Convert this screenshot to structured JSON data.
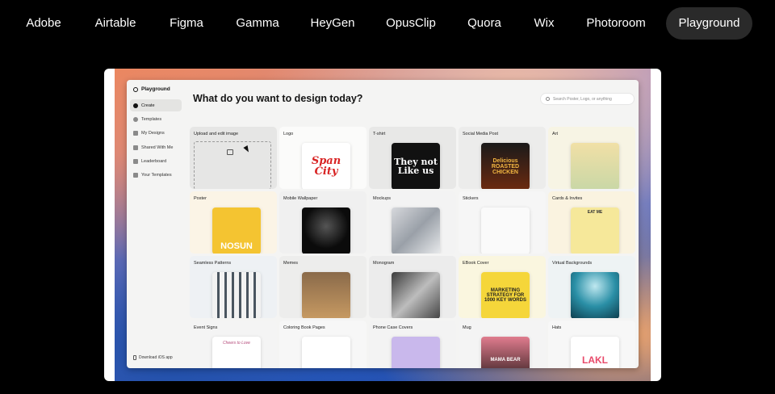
{
  "tabs": [
    {
      "label": "Adobe"
    },
    {
      "label": "Airtable"
    },
    {
      "label": "Figma"
    },
    {
      "label": "Gamma"
    },
    {
      "label": "HeyGen"
    },
    {
      "label": "OpusClip"
    },
    {
      "label": "Quora"
    },
    {
      "label": "Wix"
    },
    {
      "label": "Photoroom"
    },
    {
      "label": "Playground"
    }
  ],
  "active_tab": "Playground",
  "app": {
    "brand": "Playground",
    "nav": [
      {
        "label": "Create",
        "active": true
      },
      {
        "label": "Templates"
      },
      {
        "label": "My Designs"
      },
      {
        "label": "Shared With Me"
      },
      {
        "label": "Leaderboard"
      },
      {
        "label": "Your Templates"
      }
    ],
    "ios_link": "Download iOS app",
    "headline": "What do you want to design today?",
    "search_placeholder": "Search Poster, Logo, or anything",
    "cards": [
      {
        "label": "Upload and edit image"
      },
      {
        "label": "Logo",
        "thumb": "Span City"
      },
      {
        "label": "T-shirt",
        "thumb": "They not Like us"
      },
      {
        "label": "Social Media Post",
        "thumb": "Delicious ROASTED CHICKEN"
      },
      {
        "label": "Art"
      },
      {
        "label": "Poster",
        "thumb": "NOSUN"
      },
      {
        "label": "Mobile Wallpaper"
      },
      {
        "label": "Mockups"
      },
      {
        "label": "Stickers"
      },
      {
        "label": "Cards & Invites",
        "thumb": "EAT ME"
      },
      {
        "label": "Seamless Patterns"
      },
      {
        "label": "Memes"
      },
      {
        "label": "Monogram"
      },
      {
        "label": "EBook Cover",
        "thumb": "MARKETING STRATEGY FOR 1000 KEY WORDS"
      },
      {
        "label": "Virtual Backgrounds"
      },
      {
        "label": "Event Signs",
        "thumb": "Cheers to Love"
      },
      {
        "label": "Coloring Book Pages"
      },
      {
        "label": "Phone Case Covers"
      },
      {
        "label": "Mug",
        "thumb": "MAMA BEAR"
      },
      {
        "label": "Hats",
        "thumb": "LAKL"
      }
    ]
  },
  "colors": {
    "page_bg": "#000000",
    "tab_active_bg": "#2a2a2a",
    "tab_text": "#ffffff"
  }
}
